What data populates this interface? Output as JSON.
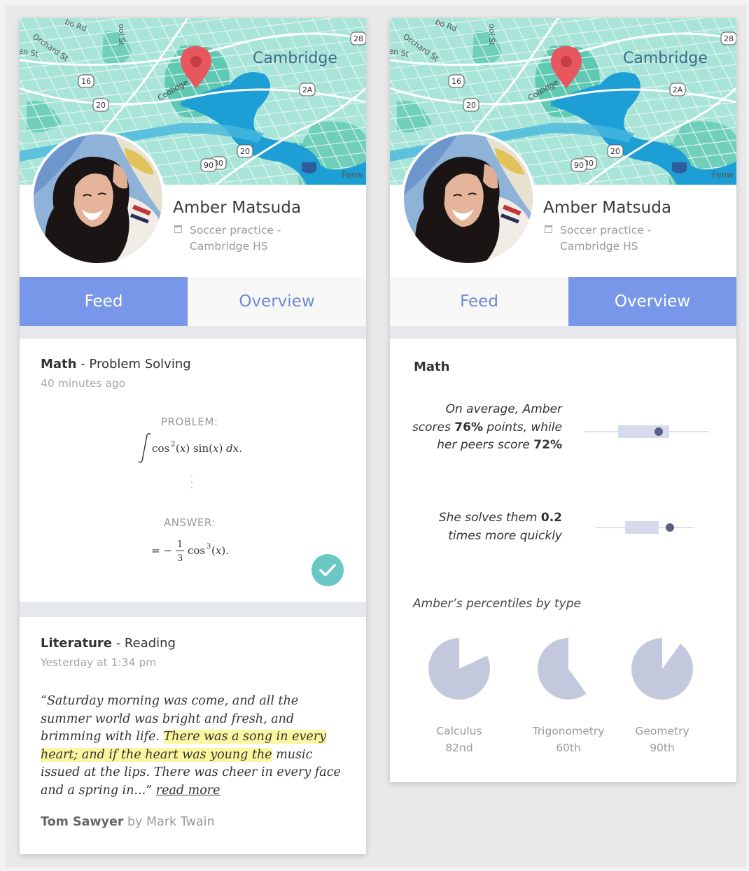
{
  "profile": {
    "name": "Amber Matsuda",
    "activity_line1": "Soccer practice -",
    "activity_line2": "Cambridge HS"
  },
  "map": {
    "labels": [
      "Cambridge",
      "Orchard St",
      "en St",
      "bo Rd",
      "ool St",
      "Coolidge",
      "Fenw"
    ],
    "road_badges": [
      "16",
      "20",
      "2A",
      "28",
      "20",
      "30",
      "90"
    ]
  },
  "tabs": {
    "feed": "Feed",
    "overview": "Overview"
  },
  "colors": {
    "accent": "#7897e8",
    "pie": "#c3c8dd",
    "check": "#6ac8c4",
    "highlight": "#fbf7a0"
  },
  "feed": {
    "math": {
      "subject": "Math",
      "topic": " - Problem Solving",
      "time": "40 minutes ago",
      "problem_label": "PROBLEM:",
      "problem_formula": "∫ cos²(x) sin(x) dx.",
      "answer_label": "ANSWER:",
      "answer_formula": "= −⅓ cos³(x).",
      "status_icon": "check-icon"
    },
    "literature": {
      "subject": "Literature",
      "topic": " - Reading",
      "time": "Yesterday at 1:34 pm",
      "quote_before": "“Saturday morning was come, and all the summer world was bright and fresh, and brimming with life. ",
      "quote_highlight": "There was a song in every heart; and if the heart was young the",
      "quote_after": " music issued at the lips. There was cheer in every face and a spring in...” ",
      "read_more": "read more",
      "book_title": "Tom Sawyer",
      "book_author": " by Mark Twain"
    }
  },
  "overview": {
    "subject": "Math",
    "stat1": {
      "pre": "On average, Amber scores ",
      "amber": "76%",
      "mid": " points, while her peers score ",
      "peers": "72%"
    },
    "stat2": {
      "pre": "She solves them ",
      "value": "0.2",
      "post": " times more quickly"
    },
    "percentiles_title": "Amber’s percentiles by type",
    "percentiles": [
      {
        "name": "Calculus",
        "value_label": "82nd",
        "pct": 82
      },
      {
        "name": "Trigonometry",
        "value_label": "60th",
        "pct": 60
      },
      {
        "name": "Geometry",
        "value_label": "90th",
        "pct": 90
      }
    ]
  }
}
